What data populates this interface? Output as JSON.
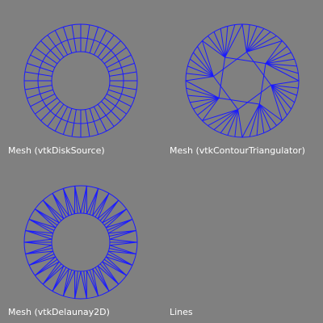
{
  "colors": {
    "background": "#808080",
    "mesh": "#1a1aff",
    "label": "#ffffff"
  },
  "viewports": [
    {
      "label": "Mesh (vtkDiskSource)",
      "mesh": "disk-source"
    },
    {
      "label": "Mesh (vtkContourTriangulator)",
      "mesh": "contour-triangulator"
    },
    {
      "label": "Mesh (vtkDelaunay2D)",
      "mesh": "delaunay2d"
    },
    {
      "label": "Lines",
      "mesh": "none"
    }
  ]
}
